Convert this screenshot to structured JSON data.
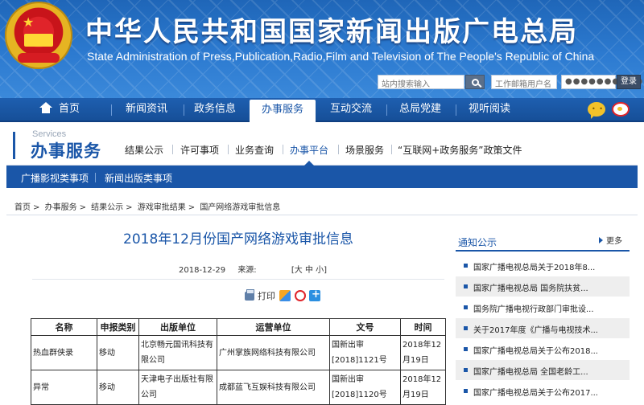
{
  "header": {
    "title_cn": "中华人民共和国国家新闻出版广电总局",
    "title_en": "State Administration of Press,Publication,Radio,Film and Television of The People's Republic of China",
    "search_placeholder": "站内搜索输入",
    "username_placeholder": "工作邮箱用户名",
    "password_value": "●●●●●●●●●●",
    "login_label": "登录",
    "colors": {
      "header_blue": "#2c7ad0",
      "nav_blue": "#1a56a8"
    }
  },
  "nav": {
    "items": [
      {
        "label": "首页",
        "icon": "home-icon"
      },
      {
        "label": "新闻资讯"
      },
      {
        "label": "政务信息"
      },
      {
        "label": "办事服务",
        "active": true
      },
      {
        "label": "互动交流"
      },
      {
        "label": "总局党建"
      },
      {
        "label": "视听阅读"
      }
    ]
  },
  "services": {
    "en": "Services",
    "cn": "办事服务",
    "links": [
      "结果公示",
      "许可事项",
      "业务查询",
      "办事平台",
      "场景服务",
      "“互联网+政务服务”政策文件"
    ],
    "active_link": "办事平台"
  },
  "categories": [
    "广播影视类事项",
    "新闻出版类事项"
  ],
  "breadcrumb": [
    "首页",
    "办事服务",
    "结果公示",
    "游戏审批结果",
    "国产网络游戏审批信息"
  ],
  "breadcrumb_sep": ">",
  "article": {
    "title": "2018年12月份国产网络游戏审批信息",
    "date": "2018-12-29",
    "source_label": "来源:",
    "font_size_label": "[大 中 小]",
    "print_label": "打印"
  },
  "table": {
    "headers": [
      "名称",
      "申报类别",
      "出版单位",
      "运营单位",
      "文号",
      "时间"
    ],
    "rows": [
      [
        "热血群侠录",
        "移动",
        "北京畅元国讯科技有限公司",
        "广州掌族网络科技有限公司",
        "国新出审[2018]1121号",
        "2018年12月19日"
      ],
      [
        "异常",
        "移动",
        "天津电子出版社有限公司",
        "成都蓝飞互娱科技有限公司",
        "国新出审[2018]1120号",
        "2018年12月19日"
      ]
    ]
  },
  "notice": {
    "title": "通知公示",
    "more": "更多",
    "items": [
      "国家广播电视总局关于2018年8...",
      "国家广播电视总局 国务院扶贫...",
      "国务院广播电视行政部门审批设...",
      "关于2017年度《广播与电视技术...",
      "国家广播电视总局关于公布2018...",
      "国家广播电视总局 全国老龄工...",
      "国家广播电视总局关于公布2017..."
    ]
  }
}
